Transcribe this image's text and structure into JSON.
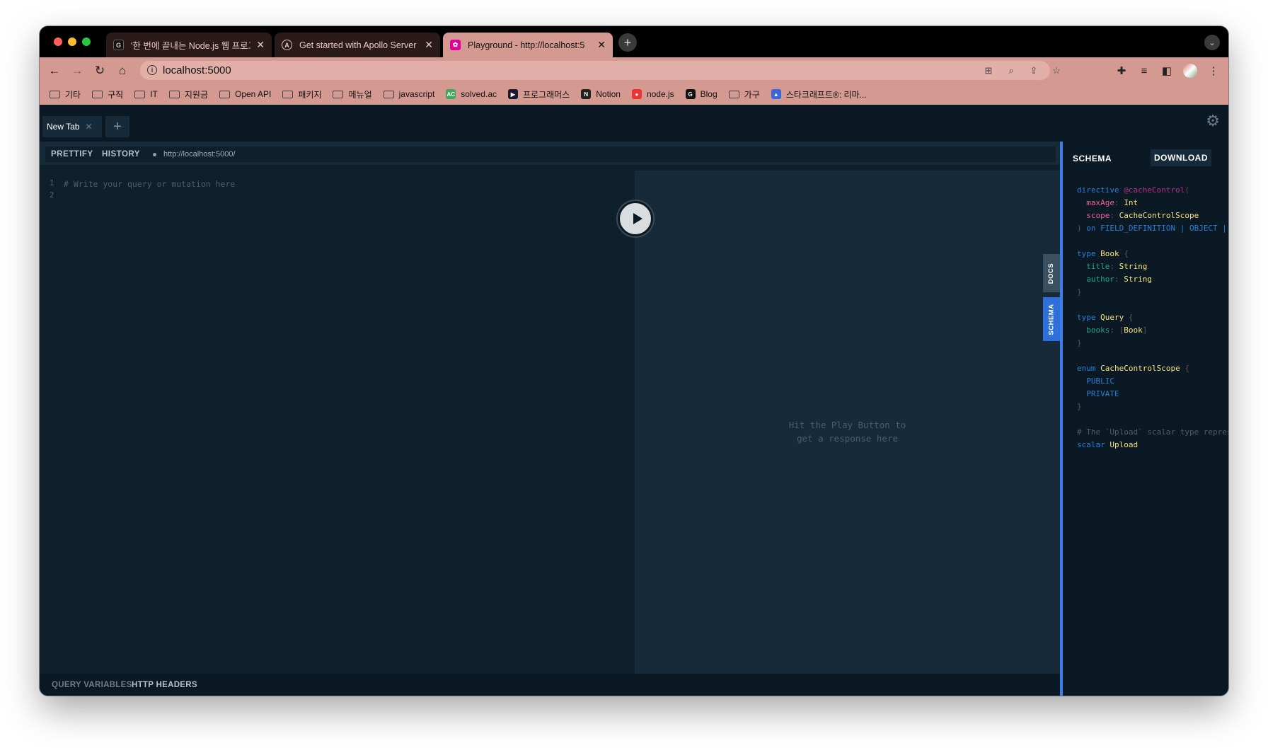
{
  "browser": {
    "tabs": [
      {
        "title": "'한 번에 끝내는 Node.js 웹 프로그",
        "favicon": "G"
      },
      {
        "title": "Get started with Apollo Server",
        "favicon": "A"
      },
      {
        "title": "Playground - http://localhost:5",
        "favicon": "✿"
      }
    ],
    "url": "localhost:5000",
    "bookmarks": [
      {
        "label": "기타",
        "type": "folder"
      },
      {
        "label": "구직",
        "type": "folder"
      },
      {
        "label": "IT",
        "type": "folder"
      },
      {
        "label": "지원금",
        "type": "folder"
      },
      {
        "label": "Open API",
        "type": "folder"
      },
      {
        "label": "패키지",
        "type": "folder"
      },
      {
        "label": "메뉴얼",
        "type": "folder"
      },
      {
        "label": "javascript",
        "type": "folder"
      },
      {
        "label": "solved.ac",
        "type": "site",
        "fav": "AC"
      },
      {
        "label": "프로그래머스",
        "type": "site",
        "fav": "▶"
      },
      {
        "label": "Notion",
        "type": "site",
        "fav": "N"
      },
      {
        "label": "node.js",
        "type": "site",
        "fav": "●"
      },
      {
        "label": "Blog",
        "type": "site",
        "fav": "G"
      },
      {
        "label": "가구",
        "type": "folder"
      },
      {
        "label": "스타크래프트®: 리마...",
        "type": "site",
        "fav": "▲"
      }
    ]
  },
  "playground": {
    "tab_label": "New Tab",
    "prettify": "PRETTIFY",
    "history": "HISTORY",
    "endpoint": "http://localhost:5000/",
    "editor_line_numbers": [
      "1",
      "2"
    ],
    "editor_placeholder": "# Write your query or mutation here",
    "result_hint_line1": "Hit the Play Button to",
    "result_hint_line2": "get a response here",
    "side_docs": "DOCS",
    "side_schema": "SCHEMA",
    "footer_query_variables": "QUERY VARIABLES",
    "footer_http_headers": "HTTP HEADERS",
    "schema_title": "SCHEMA",
    "download": "DOWNLOAD"
  }
}
